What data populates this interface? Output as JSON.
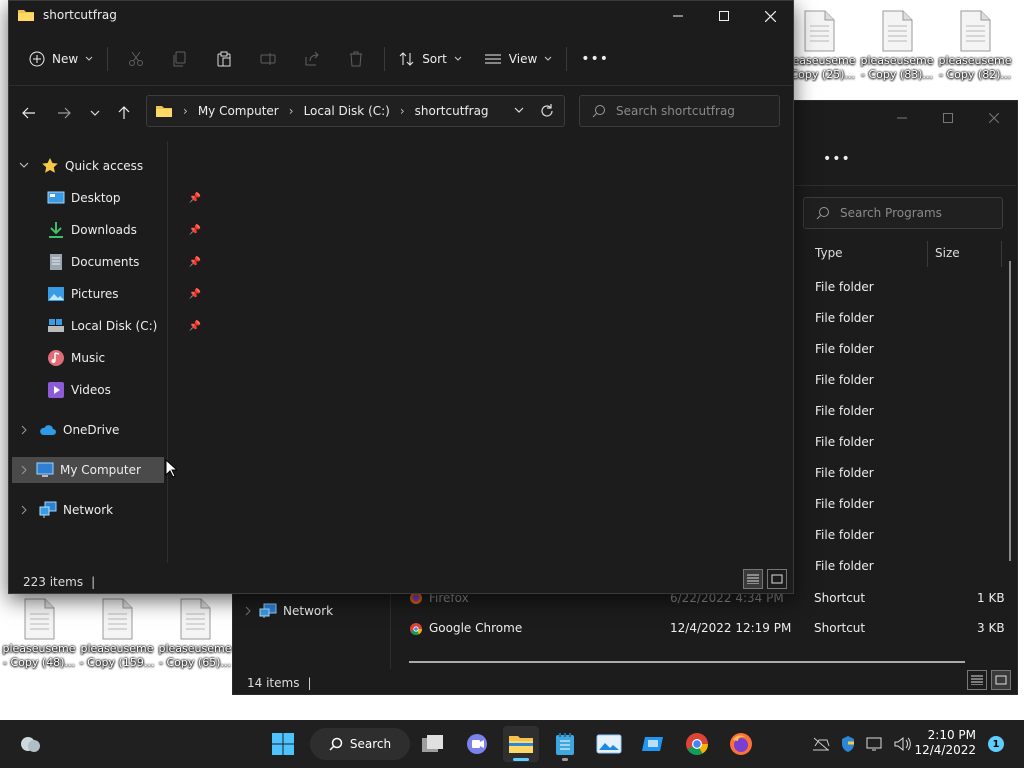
{
  "desktop": {
    "icons_top": [
      {
        "line1": "pleaseuseme",
        "line2": "- Copy (25)..."
      },
      {
        "line1": "pleaseuseme",
        "line2": "- Copy (83)..."
      },
      {
        "line1": "pleaseuseme",
        "line2": "- Copy (82)..."
      }
    ],
    "icons_bottom": [
      {
        "line1": "pleaseuseme",
        "line2": "- Copy (48)..."
      },
      {
        "line1": "pleaseuseme",
        "line2": "- Copy (159..."
      },
      {
        "line1": "pleaseuseme",
        "line2": "- Copy (65)..."
      }
    ]
  },
  "bg_window": {
    "search_placeholder": "Search Programs",
    "more_label": "•••",
    "columns": {
      "type": "Type",
      "size": "Size"
    },
    "folder_rows": [
      "File folder",
      "File folder",
      "File folder",
      "File folder",
      "File folder",
      "File folder",
      "File folder",
      "File folder",
      "File folder",
      "File folder"
    ],
    "rows": [
      {
        "name": "Firefox",
        "date": "6/22/2022 4:34 PM",
        "type": "Shortcut",
        "size": "1 KB"
      },
      {
        "name": "Google Chrome",
        "date": "12/4/2022 12:19 PM",
        "type": "Shortcut",
        "size": "3 KB"
      }
    ],
    "nav_network": "Network",
    "status": "14 items"
  },
  "fg_window": {
    "title": "shortcutfrag",
    "cmd": {
      "new": "New",
      "sort": "Sort",
      "view": "View",
      "more": "•••"
    },
    "breadcrumb": [
      "My Computer",
      "Local Disk (C:)",
      "shortcutfrag"
    ],
    "search_placeholder": "Search shortcutfrag",
    "nav": {
      "quick_access": "Quick access",
      "items": [
        {
          "label": "Desktop",
          "pinned": true
        },
        {
          "label": "Downloads",
          "pinned": true
        },
        {
          "label": "Documents",
          "pinned": true
        },
        {
          "label": "Pictures",
          "pinned": true
        },
        {
          "label": "Local Disk (C:)",
          "pinned": true
        },
        {
          "label": "Music",
          "pinned": false
        },
        {
          "label": "Videos",
          "pinned": false
        }
      ],
      "onedrive": "OneDrive",
      "my_computer": "My Computer",
      "network": "Network"
    },
    "status": "223 items"
  },
  "taskbar": {
    "search_label": "Search",
    "time": "2:10 PM",
    "date": "12/4/2022",
    "notifications": "1"
  },
  "colors": {
    "accent": "#60cdff",
    "folder": "#f2c14e",
    "window_bg": "#1c1c1c",
    "taskbar_bg": "#202020"
  }
}
